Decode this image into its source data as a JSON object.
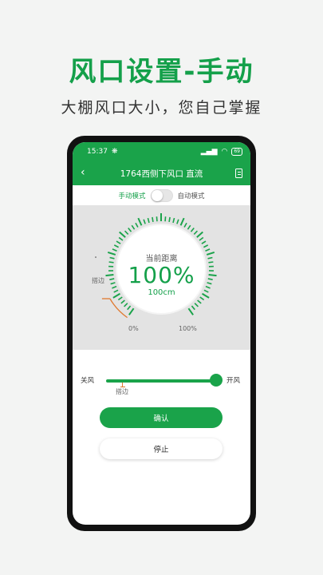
{
  "promo": {
    "title": "风口设置-手动",
    "subtitle": "大棚风口大小，您自己掌握"
  },
  "status_bar": {
    "time": "15:37",
    "battery": "69"
  },
  "nav": {
    "title": "1764西侧下风口 直流"
  },
  "mode": {
    "manual_label": "手动模式",
    "auto_label": "自动模式",
    "auto_enabled": false
  },
  "gauge": {
    "title": "当前距离",
    "value_text": "100%",
    "distance_text": "100cm",
    "min_label": "0%",
    "max_label": "100%",
    "marker_label": "搭边",
    "percent": 100
  },
  "slider": {
    "left_label": "关风",
    "right_label": "开风",
    "marker_label": "搭边",
    "value_percent": 100
  },
  "buttons": {
    "confirm_label": "确认",
    "stop_label": "停止"
  },
  "colors": {
    "brand_green": "#1aa34a",
    "marker_orange": "#e07a30"
  }
}
